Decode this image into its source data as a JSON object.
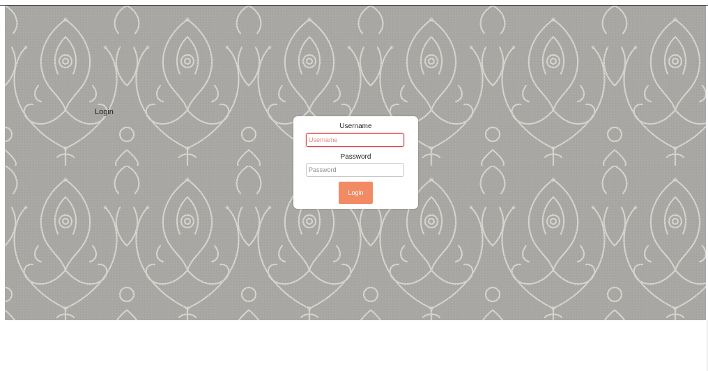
{
  "page": {
    "label": "Login"
  },
  "form": {
    "username_label": "Username",
    "username_placeholder": "Username",
    "username_value": "",
    "password_label": "Password",
    "password_placeholder": "Password",
    "password_value": "",
    "submit_label": "Login"
  },
  "background": {
    "pattern": "damask-pattern",
    "color": "#a8a7a3",
    "pattern_color": "#dddcd8"
  },
  "colors": {
    "accent": "#f28a63",
    "focus_border": "#d84747"
  }
}
